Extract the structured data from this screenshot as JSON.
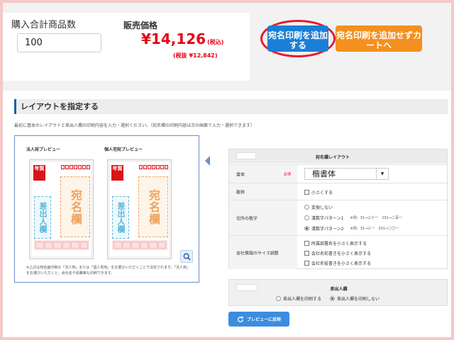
{
  "purchase": {
    "qty_label": "購入合計商品数",
    "qty_value": "100",
    "price_label": "販売価格",
    "price_value": "¥14,126",
    "price_tax_note": "(税込)",
    "price_ex_tax": "(税抜 ¥12,842)"
  },
  "buttons": {
    "add_print": "宛名印刷を追加する",
    "skip_print": "宛名印刷を追加せずカートへ"
  },
  "layout_section": {
    "title": "レイアウトを指定する",
    "intro": "最初に基本のレイアウトと差出人欄の印刷内容を入力・選択ください。（宛名欄の印刷内容は次の画面で入力・選択できます）"
  },
  "preview": {
    "corporate_label": "法人宛プレビュー",
    "personal_label": "個人宅宛プレビュー",
    "nenga": "年賀",
    "name_field": "宛名欄",
    "sender_field": "差出人欄",
    "note": "※上記は宛名面印刷の「法人宛」または「個人宅宛」をお選びいただくことで決定されます。「法人宛」をお選びいただくと、会社名や役職等も印刷できます。"
  },
  "settings": {
    "title": "宛名欄レイアウト",
    "font_label": "書体",
    "required": "必須",
    "font_value": "楷書体",
    "honorific_label": "敬称",
    "honorific_option": "小さくする",
    "number_label": "住所の数字",
    "number_options": [
      {
        "label": "変換しない",
        "example": ""
      },
      {
        "label": "漢数字パターン1",
        "example": "※例：31→三十一　201→二百一"
      },
      {
        "label": "漢数字パターン2",
        "example": "※例：31→三一　201→二〇一"
      }
    ],
    "company_label": "会社情報のサイズ調整",
    "company_options": [
      "所属部署名を小さく表示する",
      "会社名前書きを小さく表示する",
      "会社名役書きを小さく表示する"
    ]
  },
  "sender": {
    "title": "差出人欄",
    "option_print": "差出人欄を印刷する",
    "option_noprint": "差出人欄を印刷しない"
  },
  "apply_button": "プレビューに反映",
  "colors": {
    "price_red": "#e60012",
    "button_blue": "#1a7fd6",
    "button_orange": "#f39020",
    "highlight_ring": "#e8182c",
    "apply_blue": "#3b8de0"
  },
  "icons": {
    "zoom": "magnifier-icon",
    "refresh": "refresh-icon",
    "select_arrow": "chevron-down-icon"
  }
}
